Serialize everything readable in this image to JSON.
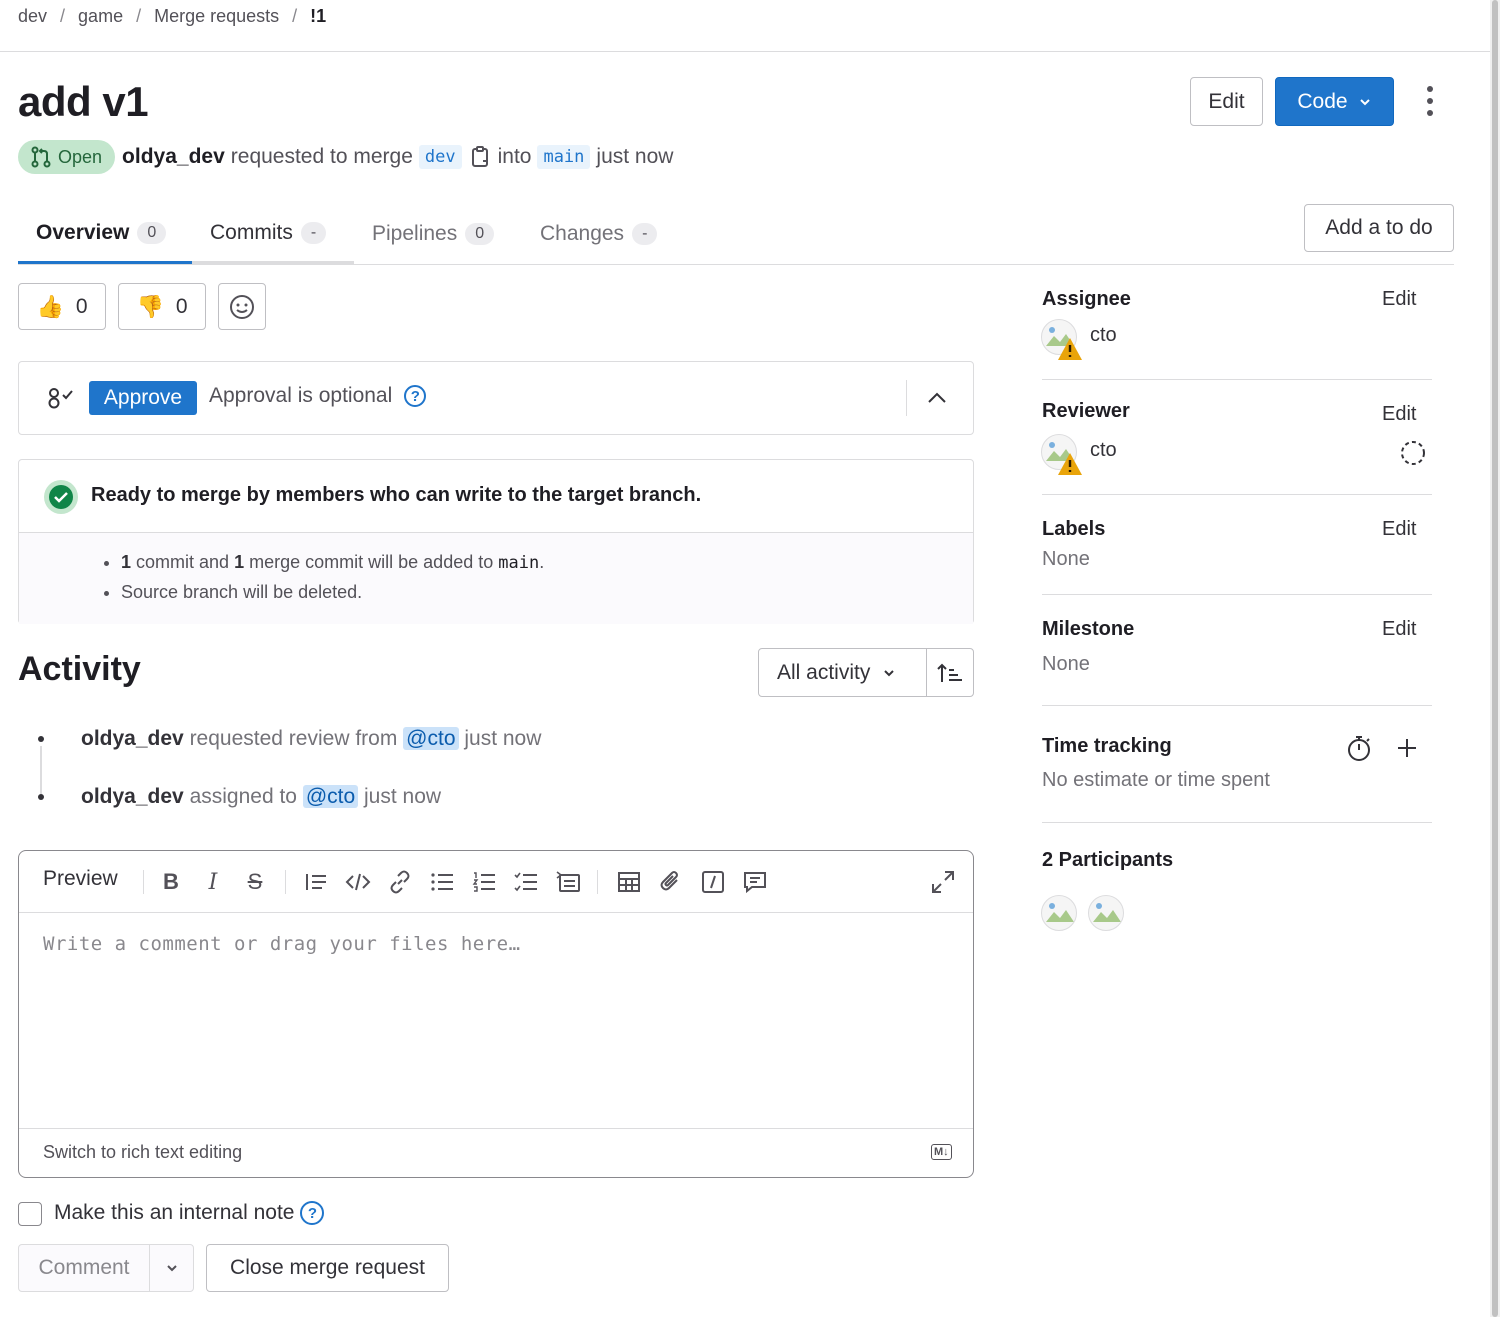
{
  "breadcrumb": [
    "dev",
    "game",
    "Merge requests",
    "!1"
  ],
  "title": "add v1",
  "header_buttons": {
    "edit": "Edit",
    "code": "Code"
  },
  "status": {
    "badge": "Open",
    "author": "oldya_dev",
    "action": "requested to merge",
    "source_branch": "dev",
    "into": "into",
    "target_branch": "main",
    "time": "just now"
  },
  "tabs": [
    {
      "label": "Overview",
      "count": "0"
    },
    {
      "label": "Commits",
      "count": "-"
    },
    {
      "label": "Pipelines",
      "count": "0"
    },
    {
      "label": "Changes",
      "count": "-"
    }
  ],
  "add_todo": "Add a to do",
  "reactions": {
    "thumbs_up": "0",
    "thumbs_down": "0"
  },
  "approval": {
    "button": "Approve",
    "text": "Approval is optional",
    "icon": "approval-icon"
  },
  "ready": {
    "title": "Ready to merge by members who can write to the target branch.",
    "items": {
      "commit_count": "1",
      "commit_text": "commit and",
      "merge_count": "1",
      "merge_text": "merge commit will be added to",
      "target": "main",
      "deleted": "Source branch will be deleted."
    }
  },
  "activity": {
    "heading": "Activity",
    "filter": "All activity",
    "events": [
      {
        "user": "oldya_dev",
        "action": "requested review from",
        "mention": "@cto",
        "time": "just now"
      },
      {
        "user": "oldya_dev",
        "action": "assigned to",
        "mention": "@cto",
        "time": "just now"
      }
    ]
  },
  "editor": {
    "preview": "Preview",
    "placeholder": "Write a comment or drag your files here…",
    "switch": "Switch to rich text editing",
    "md_badge": "M↓"
  },
  "internal_note": "Make this an internal note",
  "actions": {
    "comment": "Comment",
    "close": "Close merge request"
  },
  "sidebar": {
    "edit": "Edit",
    "assignee": {
      "title": "Assignee",
      "name": "cto"
    },
    "reviewer": {
      "title": "Reviewer",
      "name": "cto"
    },
    "labels": {
      "title": "Labels",
      "value": "None"
    },
    "milestone": {
      "title": "Milestone",
      "value": "None"
    },
    "time_tracking": {
      "title": "Time tracking",
      "value": "No estimate or time spent"
    },
    "participants": {
      "title": "2 Participants"
    }
  },
  "colors": {
    "primary": "#1f75cb",
    "success": "#108548",
    "open_badge": "#c3e6cd"
  }
}
